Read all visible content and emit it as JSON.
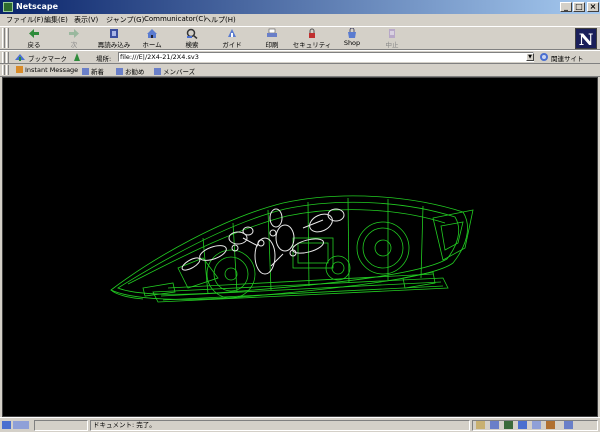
{
  "window": {
    "title": "Netscape",
    "controls": [
      "_",
      "□",
      "×"
    ]
  },
  "menu": [
    "ファイル(F)",
    "編集(E)",
    "表示(V)",
    "ジャンプ(G)",
    "Communicator(C)",
    "ヘルプ(H)"
  ],
  "toolbar": {
    "buttons": [
      {
        "label": "戻る",
        "icon": "back-arrow-icon"
      },
      {
        "label": "次",
        "icon": "forward-arrow-icon",
        "disabled": true
      },
      {
        "label": "再読み込み",
        "icon": "reload-icon"
      },
      {
        "label": "ホーム",
        "icon": "home-icon"
      },
      {
        "label": "検索",
        "icon": "search-icon"
      },
      {
        "label": "ガイド",
        "icon": "guide-icon"
      },
      {
        "label": "印刷",
        "icon": "print-icon"
      },
      {
        "label": "セキュリティ",
        "icon": "lock-icon"
      },
      {
        "label": "Shop",
        "icon": "shop-icon"
      },
      {
        "label": "中止",
        "icon": "stop-icon",
        "disabled": true
      }
    ],
    "logo": "N"
  },
  "location": {
    "bookmarks_label": "ブックマーク",
    "location_label": "場所:",
    "url": "file:///E|/2X4-21/2X4.sv3",
    "related_label": "関連サイト"
  },
  "personal": [
    "Instant Message",
    "新着",
    "お勧め",
    "メンバーズ"
  ],
  "status": {
    "text": "ドキュメント: 完了。"
  },
  "colors": {
    "wireframe": "#22cc22",
    "skeleton": "#e8e8e8",
    "background": "#000000"
  }
}
